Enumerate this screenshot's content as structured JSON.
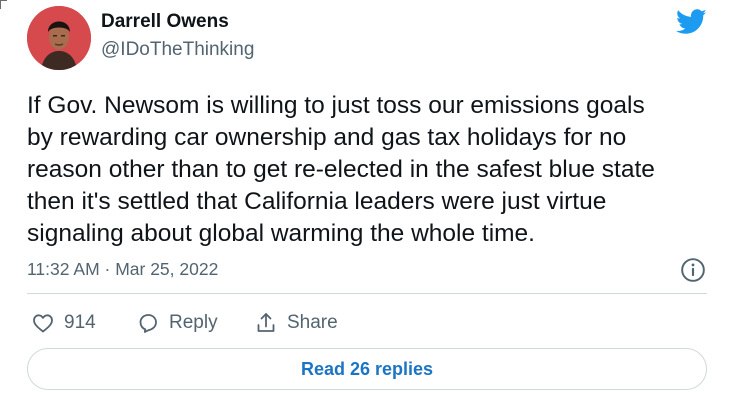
{
  "author": {
    "name": "Darrell Owens",
    "handle": "@IDoTheThinking",
    "avatar_icon": "profile-photo",
    "avatar_color": "#d64a4e"
  },
  "brand": {
    "icon": "twitter-bird-icon",
    "color": "#1d9bf0"
  },
  "tweet": {
    "text": "If Gov. Newsom is willing to just toss our emissions goals\nby rewarding car ownership and gas tax holidays for no\nreason other than to get re-elected in the safest blue state\nthen it's settled that California leaders were just virtue\nsignaling about global warming the whole time.",
    "timestamp": "11:32 AM · Mar 25, 2022"
  },
  "actions": {
    "like_count": "914",
    "reply_label": "Reply",
    "share_label": "Share"
  },
  "footer": {
    "read_replies_label": "Read 26 replies",
    "link_color": "#1b74c4"
  }
}
